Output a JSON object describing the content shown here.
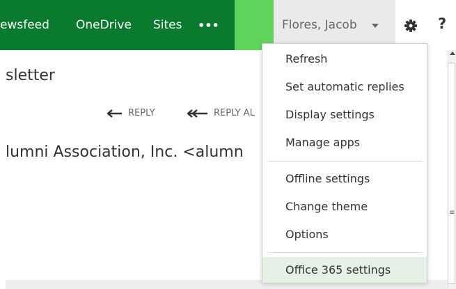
{
  "topbar": {
    "nav": [
      "ewsfeed",
      "OneDrive",
      "Sites",
      "•••"
    ],
    "user": "Flores, Jacob",
    "help": "?"
  },
  "email": {
    "subject": "sletter",
    "reply": "REPLY",
    "reply_all": "REPLY AL",
    "from": "lumni Association, Inc. <alumn"
  },
  "menu": {
    "items": [
      "Refresh",
      "Set automatic replies",
      "Display settings",
      "Manage apps",
      "Offline settings",
      "Change theme",
      "Options",
      "Office 365 settings"
    ]
  },
  "colors": {
    "topbar": "#0a7a2f",
    "accent": "#5fd45a",
    "menu_highlight": "#e4f1e4"
  }
}
